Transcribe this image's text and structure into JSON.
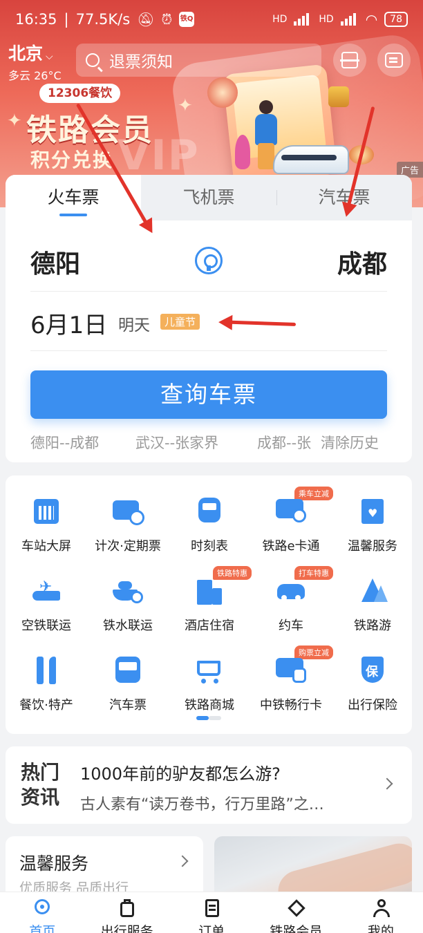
{
  "status_bar": {
    "time": "16:35",
    "speed": "77.5K/s",
    "app_badge": "铁Q",
    "network1": "HD",
    "network2": "HD",
    "battery": "78"
  },
  "header": {
    "city": "北京",
    "weather": "多云 26°C",
    "search_placeholder": "退票须知"
  },
  "banner": {
    "tag": "12306餐饮",
    "title": "铁路会员",
    "subtitle": "积分兑换",
    "watermark": "VIP",
    "ad_label": "广告"
  },
  "booking": {
    "tabs": [
      {
        "label": "火车票",
        "active": true
      },
      {
        "label": "飞机票",
        "active": false
      },
      {
        "label": "汽车票",
        "active": false
      }
    ],
    "from": "德阳",
    "to": "成都",
    "date": "6月1日",
    "date_relative": "明天",
    "holiday": "儿童节",
    "query_label": "查询车票",
    "history": [
      "德阳--成都",
      "武汉--张家界",
      "成都--张",
      "清除历史"
    ]
  },
  "services": [
    {
      "label": "车站大屏",
      "icon": "station-screen-icon",
      "badge": ""
    },
    {
      "label": "计次·定期票",
      "icon": "ticket-clock-icon",
      "badge": ""
    },
    {
      "label": "时刻表",
      "icon": "timetable-train-icon",
      "badge": ""
    },
    {
      "label": "铁路e卡通",
      "icon": "ecard-icon",
      "badge": "乘车立减"
    },
    {
      "label": "温馨服务",
      "icon": "heart-service-icon",
      "badge": ""
    },
    {
      "label": "空铁联运",
      "icon": "plane-train-icon",
      "badge": ""
    },
    {
      "label": "铁水联运",
      "icon": "ship-train-icon",
      "badge": ""
    },
    {
      "label": "酒店住宿",
      "icon": "hotel-icon",
      "badge": "铁路特惠"
    },
    {
      "label": "约车",
      "icon": "car-icon",
      "badge": "打车特惠"
    },
    {
      "label": "铁路游",
      "icon": "mountain-icon",
      "badge": ""
    },
    {
      "label": "餐饮·特产",
      "icon": "fork-knife-icon",
      "badge": ""
    },
    {
      "label": "汽车票",
      "icon": "bus-icon",
      "badge": ""
    },
    {
      "label": "铁路商城",
      "icon": "cart-icon",
      "badge": ""
    },
    {
      "label": "中铁畅行卡",
      "icon": "card-train-icon",
      "badge": "购票立减"
    },
    {
      "label": "出行保险",
      "icon": "shield-insurance-icon",
      "badge": ""
    }
  ],
  "services_page": {
    "current": 1,
    "total": 2
  },
  "news": {
    "tag": "热门资讯",
    "title": "1000年前的驴友都怎么游?",
    "subtitle": "古人素有“读万卷书，行万里路”之…"
  },
  "warm_service": {
    "title": "温馨服务",
    "subtitle": "优质服务 品质出行"
  },
  "bottom_nav": [
    {
      "label": "首页",
      "icon": "home-icon",
      "active": true
    },
    {
      "label": "出行服务",
      "icon": "luggage-icon",
      "active": false
    },
    {
      "label": "订单",
      "icon": "order-icon",
      "active": false
    },
    {
      "label": "铁路会员",
      "icon": "diamond-icon",
      "active": false
    },
    {
      "label": "我的",
      "icon": "person-icon",
      "active": false
    }
  ],
  "colors": {
    "accent": "#3b8ff0",
    "banner_red": "#d8443e",
    "badge_orange": "#f06c4c",
    "holiday_orange": "#f4b05b",
    "annotation_red": "#e2332a"
  }
}
